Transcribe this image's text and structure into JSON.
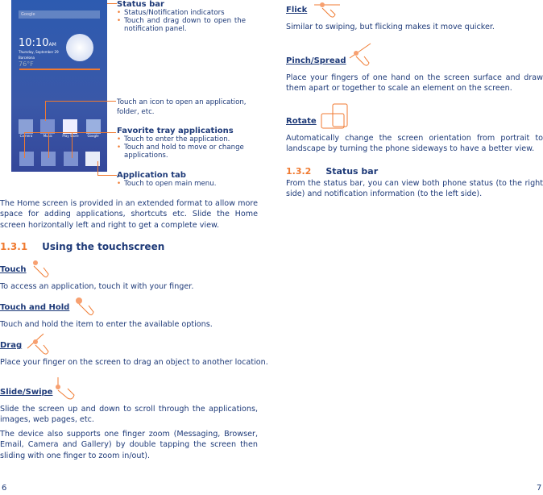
{
  "phone": {
    "search": "Google",
    "time": "10:10",
    "ampm": "AM",
    "date": "Thursday, September 29",
    "city": "Barcelona",
    "temp": "76°F",
    "apps": [
      "Camera",
      "Music",
      "Play Store",
      "Google"
    ]
  },
  "callouts": {
    "status_bar": {
      "title": "Status bar",
      "bullets": [
        "Status/Notification indicators",
        "Touch and drag down to open the notification panel."
      ]
    },
    "touch_icon": "Touch an icon to open an application, folder, etc.",
    "favorite": {
      "title": "Favorite tray applications",
      "bullets": [
        "Touch to enter the application.",
        "Touch and hold to move or change applications."
      ]
    },
    "app_tab": {
      "title": "Application tab",
      "bullets": [
        "Touch to open main menu."
      ]
    }
  },
  "left": {
    "intro": "The Home screen is provided in an extended format to allow more space for adding applications, shortcuts etc. Slide the Home screen horizontally left and right to get a complete view.",
    "section_num": "1.3.1",
    "section_title": "Using the touchscreen",
    "touch": {
      "h": "Touch",
      "p": "To access an application, touch it with your finger."
    },
    "hold": {
      "h": "Touch and Hold",
      "p": "Touch and hold the item to enter the available options."
    },
    "drag": {
      "h": "Drag",
      "p": "Place your finger on the screen to drag an object to another location."
    },
    "slide": {
      "h": "Slide/Swipe",
      "p": "Slide the screen up and down to scroll through the applications, images, web pages, etc."
    },
    "zoom": "The device also supports one finger zoom (Messaging, Browser, Email, Camera and Gallery) by double tapping the screen then sliding with one finger to zoom in/out).",
    "page": "6"
  },
  "right": {
    "flick": {
      "h": "Flick",
      "p": "Similar to swiping, but flicking makes it move quicker."
    },
    "pinch": {
      "h": "Pinch/Spread",
      "p": "Place your fingers of one hand on the screen surface and draw them apart or together to scale an element on the screen."
    },
    "rotate": {
      "h": "Rotate",
      "p": "Automatically change the screen orientation from portrait to landscape by turning the phone sideways to have a better view."
    },
    "section_num": "1.3.2",
    "section_title": "Status bar",
    "status": "From the status bar, you can view both phone status (to the right side) and notification information (to the left side).",
    "page": "7"
  },
  "colors": {
    "text": "#1e3a78",
    "accent": "#f07a30"
  }
}
